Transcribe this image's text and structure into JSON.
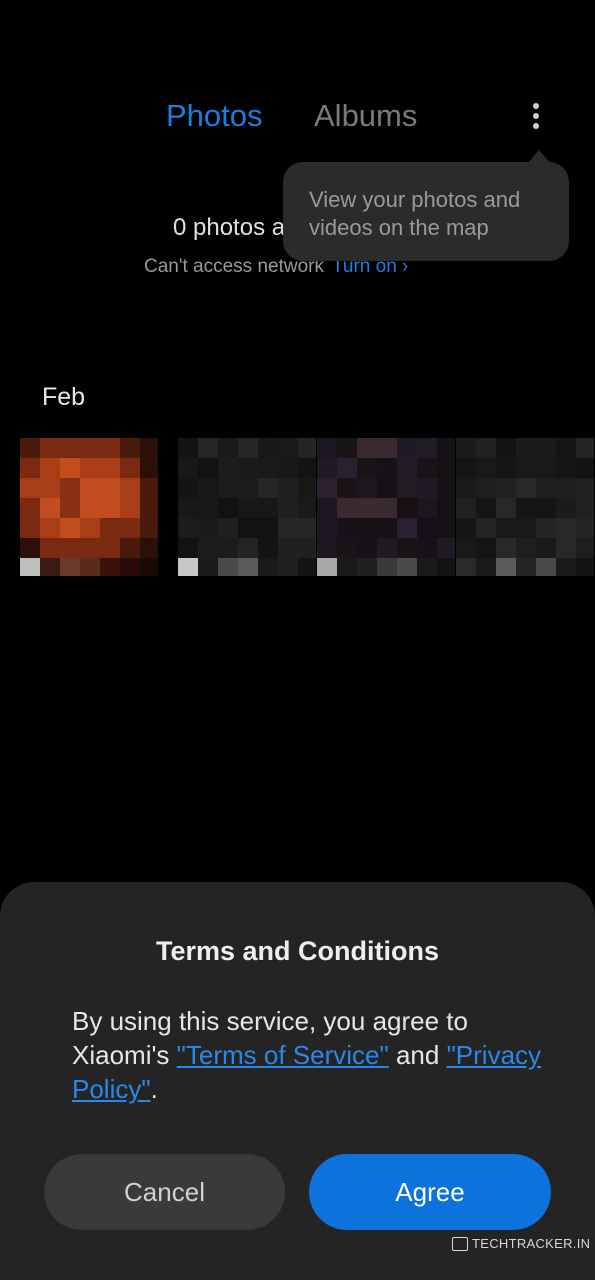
{
  "tabs": [
    {
      "label": "Photos",
      "active": true
    },
    {
      "label": "Albums",
      "active": false
    }
  ],
  "more_icon": "more-vertical-icon",
  "tooltip": {
    "text": "View your photos and videos on the map"
  },
  "status": {
    "photo_count": "0 photos a",
    "network_text": "Can't access network",
    "turn_on_label": "Turn on ›"
  },
  "gallery": {
    "month": "Feb",
    "thumbnails": [
      "photo-thumbnail-1",
      "photo-thumbnail-2",
      "photo-thumbnail-3",
      "photo-thumbnail-4"
    ]
  },
  "dialog": {
    "title": "Terms and Conditions",
    "body_prefix": "By using this service, you agree to Xiaomi's ",
    "terms_link": "\"Terms of Service\"",
    "and": " and ",
    "privacy_link": "\"Privacy Policy\"",
    "body_suffix": ".",
    "cancel_label": "Cancel",
    "agree_label": "Agree"
  },
  "watermark": {
    "text": "TECHTRACKER.IN"
  },
  "colors": {
    "accent": "#1a7fe0",
    "agree_button": "#0d73dc",
    "sheet_bg": "#242424",
    "tooltip_bg": "#2b2b2b"
  }
}
